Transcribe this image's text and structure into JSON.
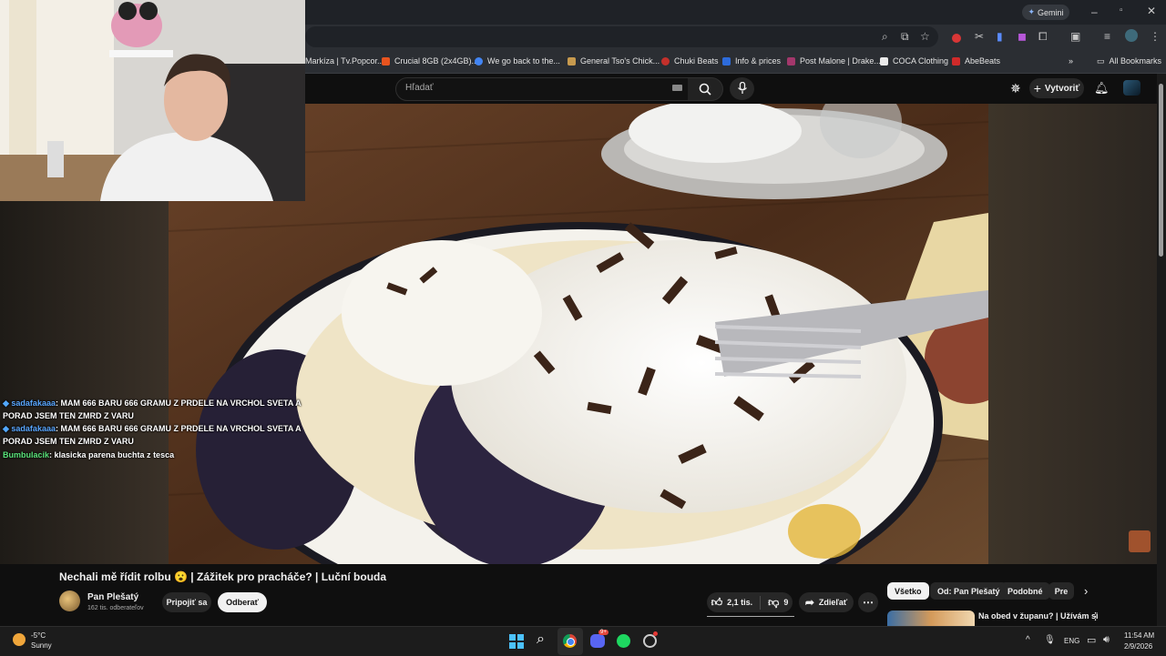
{
  "browser": {
    "gemini_label": "Gemini",
    "bookmarks": [
      {
        "label": "Markíza | Tv.Popcor...",
        "color": "#2b2e33"
      },
      {
        "label": "Crucial 8GB (2x4GB)...",
        "color": "#e8541f"
      },
      {
        "label": "We go back to the...",
        "color": "#4285f4"
      },
      {
        "label": "General Tso's Chick...",
        "color": "#c79a4e"
      },
      {
        "label": "Chuki Beats",
        "color": "#c4302b"
      },
      {
        "label": "Info & prices",
        "color": "#2d6bdb"
      },
      {
        "label": "Post Malone | Drake...",
        "color": "#a3376b"
      },
      {
        "label": "COCA Clothing",
        "color": "#eaeaea"
      },
      {
        "label": "AbeBeats",
        "color": "#d02a2a"
      }
    ],
    "all_bookmarks": "All Bookmarks"
  },
  "youtube": {
    "search_placeholder": "Hľadať",
    "create_label": "Vytvoriť"
  },
  "chat": [
    {
      "user": "sadafakaaa",
      "text": ": MAM 666 BARU 666 GRAMU Z PRDELE NA VRCHOL SVETA A PORAD JSEM TEN ZMRD Z VARU",
      "user_color": "#5aa7ff"
    },
    {
      "user": "sadafakaaa",
      "text": ": MAM 666 BARU 666 GRAMU Z PRDELE NA VRCHOL SVETA A PORAD JSEM TEN ZMRD Z VARU",
      "user_color": "#5aa7ff"
    },
    {
      "user": "Bumbulacik",
      "text": ": klasicka parena buchta z tesca",
      "user_color": "#5ae37a"
    }
  ],
  "video": {
    "title": "Nechali mě řídit rolbu 😮 | Zážitek pro pracháče? | Luční bouda",
    "channel_name": "Pan Plešatý",
    "subscribers": "162 tis. odberateľov",
    "join_label": "Pripojiť sa",
    "subscribe_label": "Odberať",
    "likes": "2,1 tis.",
    "dislikes": "9",
    "share_label": "Zdieľať",
    "more_label": "⋯"
  },
  "chips": [
    "Všetko",
    "Od: Pan Plešatý",
    "Podobné",
    "Pre"
  ],
  "suggested": {
    "line1": "Na obed v županu? | Užívám si",
    "line2": "..."
  },
  "taskbar": {
    "temperature": "-5°C",
    "weather": "Sunny",
    "language": "ENG",
    "time": "11:54 AM",
    "date": "2/9/2026",
    "discord_badge": "9+"
  }
}
